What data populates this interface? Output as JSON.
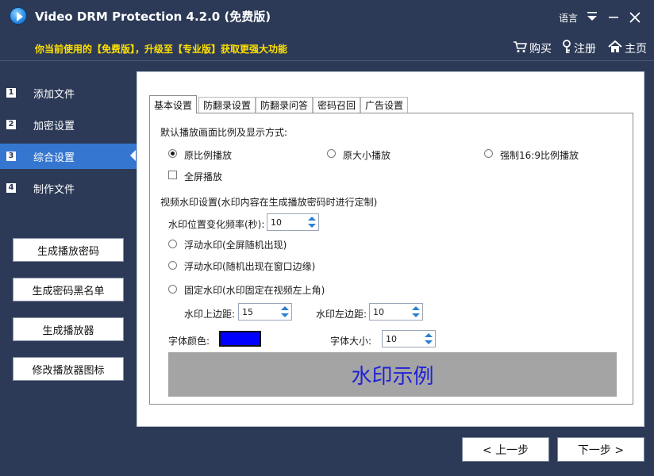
{
  "window": {
    "title": "Video DRM Protection 4.2.0 (免费版)",
    "language_label": "语言"
  },
  "promo": {
    "text": "你当前使用的【免费版】，升级至【专业版】获取更强大功能"
  },
  "header_links": {
    "buy": "购买",
    "register": "注册",
    "home": "主页"
  },
  "sidebar": {
    "steps": [
      {
        "num": "1",
        "label": "添加文件"
      },
      {
        "num": "2",
        "label": "加密设置"
      },
      {
        "num": "3",
        "label": "综合设置"
      },
      {
        "num": "4",
        "label": "制作文件"
      }
    ],
    "active_step": 3,
    "buttons": [
      {
        "label": "生成播放密码"
      },
      {
        "label": "生成密码黑名单"
      },
      {
        "label": "生成播放器"
      },
      {
        "label": "修改播放器图标"
      }
    ]
  },
  "tabs": [
    "基本设置",
    "防翻录设置",
    "防翻录问答",
    "密码召回",
    "广告设置"
  ],
  "active_tab": 0,
  "playback": {
    "section_title": "默认播放画面比例及显示方式:",
    "options": [
      "原比例播放",
      "原大小播放",
      "强制16:9比例播放"
    ],
    "selected": 0,
    "fullscreen_label": "全屏播放",
    "fullscreen_checked": false
  },
  "watermark": {
    "section_title": "视频水印设置(水印内容在生成播放密码时进行定制)",
    "freq_label": "水印位置变化频率(秒):",
    "freq_value": "10",
    "options": [
      "浮动水印(全屏随机出现)",
      "浮动水印(随机出现在窗口边缘)",
      "固定水印(水印固定在视频左上角)"
    ],
    "selected": null,
    "top_margin_label": "水印上边距:",
    "top_margin_value": "15",
    "left_margin_label": "水印左边距:",
    "left_margin_value": "10",
    "font_color_label": "字体颜色:",
    "font_color": "#0000FF",
    "font_size_label": "字体大小:",
    "font_size_value": "10",
    "preview_text": "水印示例"
  },
  "navigation": {
    "prev": "< 上一步",
    "next": "下一步 >"
  },
  "colors": {
    "background": "#2c3a57",
    "active_step": "#3577d0",
    "promo_text": "#ffe000",
    "preview_bg": "#a4a4a4",
    "preview_text": "#1f22d6"
  }
}
